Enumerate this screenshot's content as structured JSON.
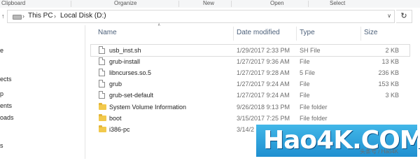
{
  "ribbon": {
    "groups": [
      "Clipboard",
      "Organize",
      "New",
      "Open",
      "Select"
    ]
  },
  "address": {
    "crumbs": [
      "This PC",
      "Local Disk (D:)"
    ]
  },
  "nav_pane": {
    "items": [
      "e",
      "ects",
      "p",
      "ents",
      "oads",
      "s"
    ]
  },
  "columns": {
    "name": "Name",
    "date": "Date modified",
    "type": "Type",
    "size": "Size"
  },
  "files": [
    {
      "name": "usb_inst.sh",
      "date": "1/29/2017 2:33 PM",
      "type": "SH File",
      "size": "2 KB",
      "kind": "file"
    },
    {
      "name": "grub-install",
      "date": "1/27/2017 9:36 AM",
      "type": "File",
      "size": "13 KB",
      "kind": "file"
    },
    {
      "name": "libncurses.so.5",
      "date": "1/27/2017 9:28 AM",
      "type": "5 File",
      "size": "236 KB",
      "kind": "file"
    },
    {
      "name": "grub",
      "date": "1/27/2017 9:24 AM",
      "type": "File",
      "size": "153 KB",
      "kind": "file"
    },
    {
      "name": "grub-set-default",
      "date": "1/27/2017 9:24 AM",
      "type": "File",
      "size": "3 KB",
      "kind": "file"
    },
    {
      "name": "System Volume Information",
      "date": "9/26/2018 9:13 PM",
      "type": "File folder",
      "size": "",
      "kind": "folder"
    },
    {
      "name": "boot",
      "date": "3/15/2017 7:25 PM",
      "type": "File folder",
      "size": "",
      "kind": "folder"
    },
    {
      "name": "i386-pc",
      "date": "3/14/2",
      "type": "",
      "size": "",
      "kind": "folder"
    }
  ],
  "watermark": {
    "text": "Hao4K.COM",
    "sub": "头条号 / Hao4K"
  },
  "colors": {
    "accent": "#1f8fd0",
    "folder": "#f2c94c"
  }
}
